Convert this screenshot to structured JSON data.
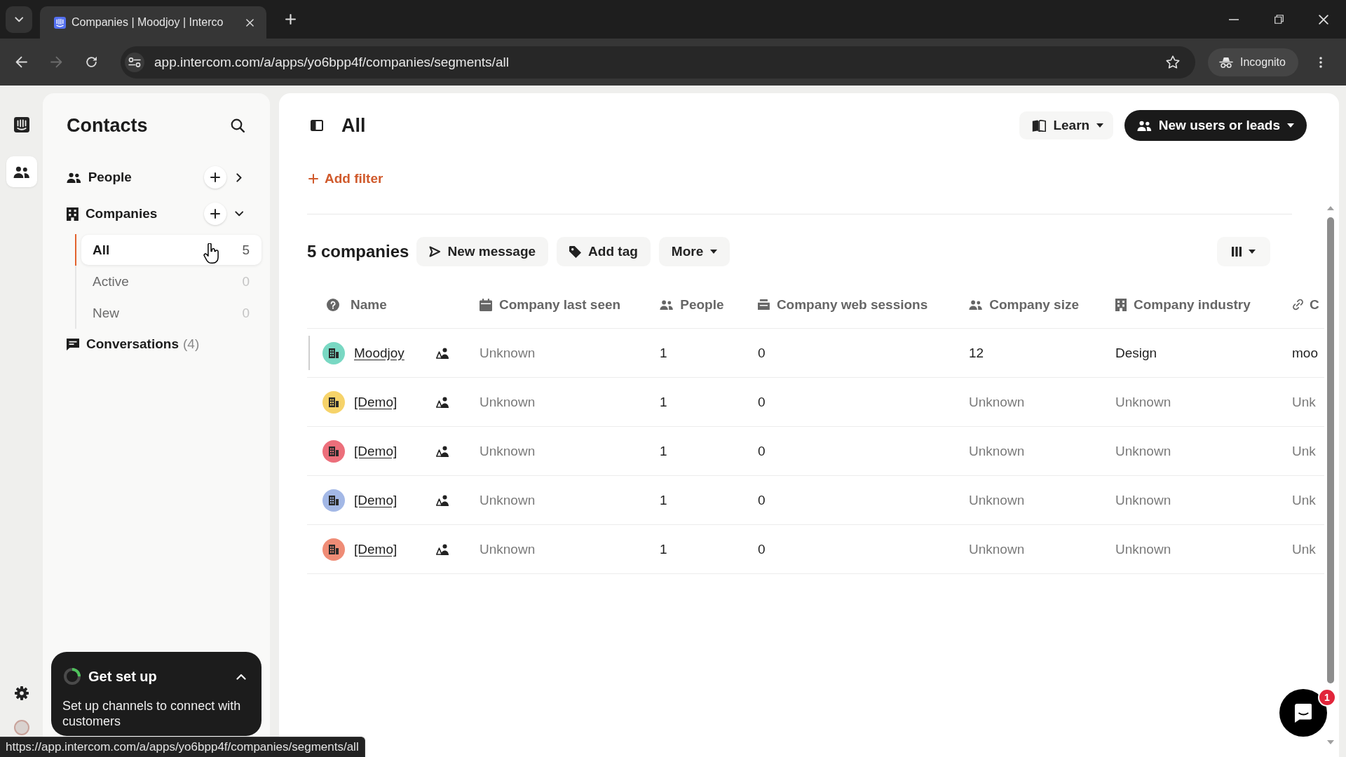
{
  "browser": {
    "tab_title": "Companies | Moodjoy | Interco",
    "url": "app.intercom.com/a/apps/yo6bpp4f/companies/segments/all",
    "profile": "Incognito",
    "forward_disabled": true,
    "status_url": "https://app.intercom.com/a/apps/yo6bpp4f/companies/segments/all"
  },
  "rail": {
    "items": [
      {
        "kind": "logo",
        "selected": false
      },
      {
        "kind": "contacts",
        "selected": true
      }
    ]
  },
  "sidebar": {
    "title": "Contacts",
    "sections": [
      {
        "kind": "people",
        "label": "People",
        "expanded": false
      },
      {
        "kind": "companies",
        "label": "Companies",
        "expanded": true,
        "children": [
          {
            "label": "All",
            "count": "5",
            "selected": true
          },
          {
            "label": "Active",
            "count": "0",
            "selected": false
          },
          {
            "label": "New",
            "count": "0",
            "selected": false
          }
        ]
      },
      {
        "kind": "conversations",
        "label": "Conversations",
        "count": "(4)"
      }
    ]
  },
  "setup_card": {
    "title": "Get set up",
    "text": "Set up channels to connect with customers",
    "expanded": true
  },
  "main": {
    "title": "All",
    "buttons": [
      {
        "kind": "secondary",
        "label": "Learn"
      },
      {
        "kind": "primary",
        "label": "New users or leads"
      }
    ],
    "add_filter": "Add filter",
    "count": "5 companies",
    "actions": [
      {
        "kind": "send",
        "label": "New message"
      },
      {
        "kind": "tag",
        "label": "Add tag"
      },
      {
        "kind": "menu",
        "label": "More"
      }
    ]
  },
  "table": {
    "columns": [
      {
        "kind": "name",
        "label": "Name"
      },
      {
        "kind": "date",
        "label": "Company last seen"
      },
      {
        "kind": "people",
        "label": "People"
      },
      {
        "kind": "number",
        "label": "Company web sessions"
      },
      {
        "kind": "size",
        "label": "Company size"
      },
      {
        "kind": "category",
        "label": "Company industry"
      },
      {
        "kind": "url",
        "label": "C"
      }
    ],
    "rows": [
      {
        "selected": true,
        "cells": [
          {
            "text": "Moodjoy",
            "color": "#79d8c3"
          },
          {
            "text": "Unknown",
            "muted": true
          },
          {
            "text": "1",
            "muted": false
          },
          {
            "text": "0",
            "muted": false
          },
          {
            "text": "12",
            "muted": false
          },
          {
            "text": "Design",
            "muted": false
          },
          {
            "text": "moo",
            "muted": false
          }
        ]
      },
      {
        "selected": false,
        "cells": [
          {
            "text": "[Demo]",
            "color": "#f6d36a"
          },
          {
            "text": "Unknown",
            "muted": true
          },
          {
            "text": "1",
            "muted": false
          },
          {
            "text": "0",
            "muted": false
          },
          {
            "text": "Unknown",
            "muted": true
          },
          {
            "text": "Unknown",
            "muted": true
          },
          {
            "text": "Unk",
            "muted": true
          }
        ]
      },
      {
        "selected": false,
        "cells": [
          {
            "text": "[Demo]",
            "color": "#ec6f7b"
          },
          {
            "text": "Unknown",
            "muted": true
          },
          {
            "text": "1",
            "muted": false
          },
          {
            "text": "0",
            "muted": false
          },
          {
            "text": "Unknown",
            "muted": true
          },
          {
            "text": "Unknown",
            "muted": true
          },
          {
            "text": "Unk",
            "muted": true
          }
        ]
      },
      {
        "selected": false,
        "cells": [
          {
            "text": "[Demo]",
            "color": "#a3b8e6"
          },
          {
            "text": "Unknown",
            "muted": true
          },
          {
            "text": "1",
            "muted": false
          },
          {
            "text": "0",
            "muted": false
          },
          {
            "text": "Unknown",
            "muted": true
          },
          {
            "text": "Unknown",
            "muted": true
          },
          {
            "text": "Unk",
            "muted": true
          }
        ]
      },
      {
        "selected": false,
        "cells": [
          {
            "text": "[Demo]",
            "color": "#ef8c76"
          },
          {
            "text": "Unknown",
            "muted": true
          },
          {
            "text": "1",
            "muted": false
          },
          {
            "text": "0",
            "muted": false
          },
          {
            "text": "Unknown",
            "muted": true
          },
          {
            "text": "Unknown",
            "muted": true
          },
          {
            "text": "Unk",
            "muted": true
          }
        ]
      }
    ]
  },
  "chat": {
    "badge": "1"
  }
}
